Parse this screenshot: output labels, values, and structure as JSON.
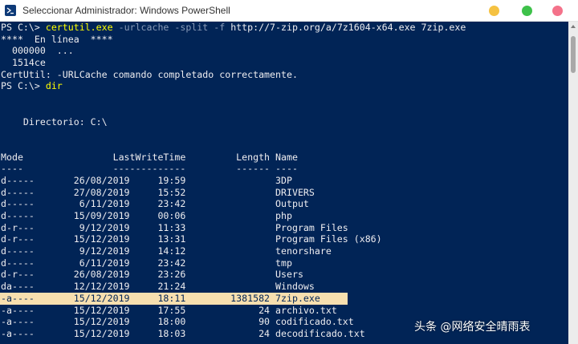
{
  "window": {
    "title": "Seleccionar Administrador: Windows PowerShell",
    "buttons": {
      "minimize_color": "#f5c242",
      "maximize_color": "#3ec14a",
      "close_color": "#f4728a"
    }
  },
  "console": {
    "colors": {
      "background": "#012456",
      "text": "#eeedf0",
      "command": "#ffff00",
      "parameter": "#8a9bb8",
      "highlight": "#f7dfaf"
    },
    "cmd1": {
      "prompt": "PS C:\\> ",
      "command": "certutil.exe",
      "params": " -urlcache -split -f",
      "args": " http://7-zip.org/a/7z1604-x64.exe 7zip.exe"
    },
    "output1": [
      "****  En línea  ****",
      "  000000  ...",
      "  1514ce",
      "CertUtil: -URLCache comando completado correctamente."
    ],
    "cmd2": {
      "prompt": "PS C:\\> ",
      "command": "dir"
    },
    "directory_line": "    Directorio: C:\\",
    "table_header": "Mode                LastWriteTime         Length Name",
    "table_rule": "----                -------------         ------ ----",
    "rows": [
      "d-----       26/08/2019     19:59                3DP",
      "d-----       27/08/2019     15:52                DRIVERS",
      "d-----        6/11/2019     23:42                Output",
      "d-----       15/09/2019     00:06                php",
      "d-r---        9/12/2019     11:33                Program Files",
      "d-r---       15/12/2019     13:31                Program Files (x86)",
      "d-----        9/12/2019     14:12                tenorshare",
      "d-----        6/11/2019     23:42                tmp",
      "d-r---       26/08/2019     23:26                Users",
      "da----       12/12/2019     21:24                Windows",
      "-a----       15/12/2019     18:11        1381582 7zip.exe",
      "-a----       15/12/2019     17:55             24 archivo.txt",
      "-a----       15/12/2019     18:00             90 codificado.txt",
      "-a----       15/12/2019     18:03             24 decodificado.txt"
    ]
  },
  "watermark": "头条 @网络安全晴雨表"
}
